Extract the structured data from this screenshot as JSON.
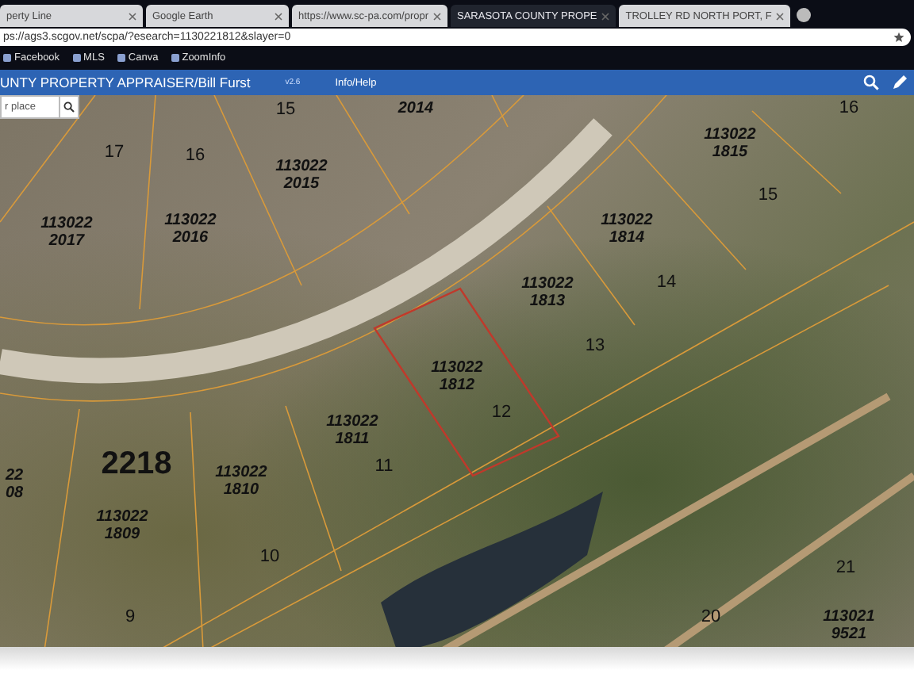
{
  "tabs": [
    {
      "title": "perty Line",
      "selected": false
    },
    {
      "title": "Google Earth",
      "selected": false
    },
    {
      "title": "https://www.sc-pa.com/propr",
      "selected": false
    },
    {
      "title": "SARASOTA COUNTY PROPE",
      "selected": true
    },
    {
      "title": "TROLLEY RD NORTH PORT, F",
      "selected": false
    }
  ],
  "address": "ps://ags3.scgov.net/scpa/?esearch=1130221812&slayer=0",
  "bookmarks": [
    "Facebook",
    "MLS",
    "Canva",
    "ZoomInfo"
  ],
  "app": {
    "title": "UNTY PROPERTY APPRAISER/Bill Furst",
    "version": "v2.6",
    "menu": "Info/Help"
  },
  "search": {
    "placeholder": "r place"
  },
  "map_labels": [
    {
      "kind": "lot",
      "text": "17"
    },
    {
      "kind": "lot",
      "text": "16"
    },
    {
      "kind": "lot",
      "text": "15"
    },
    {
      "kind": "parcel",
      "text": "2014"
    },
    {
      "kind": "lot",
      "text": "16"
    },
    {
      "kind": "parcel",
      "text": "113022 1815"
    },
    {
      "kind": "parcel",
      "text": "113022 2015"
    },
    {
      "kind": "lot",
      "text": "15"
    },
    {
      "kind": "parcel",
      "text": "113022 2017"
    },
    {
      "kind": "parcel",
      "text": "113022 2016"
    },
    {
      "kind": "parcel",
      "text": "113022 1814"
    },
    {
      "kind": "lot",
      "text": "14"
    },
    {
      "kind": "parcel",
      "text": "113022 1813"
    },
    {
      "kind": "lot",
      "text": "13"
    },
    {
      "kind": "parcel",
      "text": "113022 1812"
    },
    {
      "kind": "lot",
      "text": "12"
    },
    {
      "kind": "parcel",
      "text": "113022 1811"
    },
    {
      "kind": "parcel",
      "text": "22 08"
    },
    {
      "kind": "block",
      "text": "2218"
    },
    {
      "kind": "lot",
      "text": "11"
    },
    {
      "kind": "parcel",
      "text": "113022 1810"
    },
    {
      "kind": "parcel",
      "text": "113022 1809"
    },
    {
      "kind": "lot",
      "text": "10"
    },
    {
      "kind": "lot",
      "text": "9"
    },
    {
      "kind": "lot",
      "text": "21"
    },
    {
      "kind": "lot",
      "text": "20"
    },
    {
      "kind": "parcel",
      "text": "113021 9521"
    }
  ]
}
